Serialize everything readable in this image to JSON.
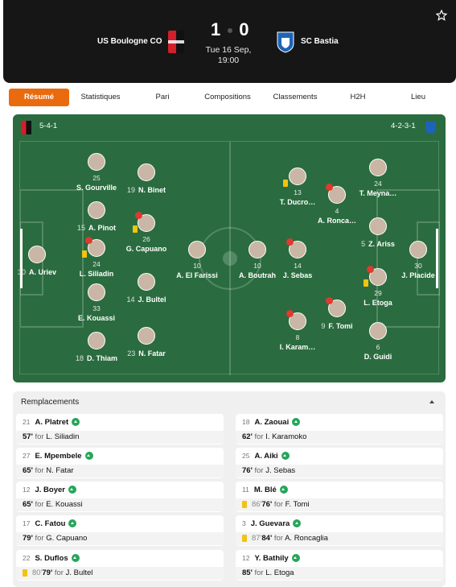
{
  "match": {
    "home_team": "US Boulogne CO",
    "away_team": "SC Bastia",
    "home_score": "1",
    "away_score": "0",
    "date": "Tue 16 Sep,",
    "time": "19:00"
  },
  "tabs": [
    "Résumé",
    "Statistiques",
    "Pari",
    "Compositions",
    "Classements",
    "H2H",
    "Lieu"
  ],
  "lineups": {
    "home_formation": "5-4-1",
    "away_formation": "4-2-3-1",
    "home_players": [
      {
        "num": "30",
        "name": "A. Uriev",
        "inline": true
      },
      {
        "num": "25",
        "name": "S. Gourville"
      },
      {
        "num": "15",
        "name": "A. Pinot",
        "inline": true
      },
      {
        "num": "24",
        "name": "L. Siliadin"
      },
      {
        "num": "33",
        "name": "E. Kouassi"
      },
      {
        "num": "18",
        "name": "D. Thiam",
        "inline": true
      },
      {
        "num": "19",
        "name": "N. Binet",
        "inline": true
      },
      {
        "num": "26",
        "name": "G. Capuano"
      },
      {
        "num": "14",
        "name": "J. Bultel",
        "inline": true
      },
      {
        "num": "23",
        "name": "N. Fatar",
        "inline": true
      },
      {
        "num": "10",
        "name": "A. El Farissi"
      }
    ],
    "away_players": [
      {
        "num": "10",
        "name": "A. Boutrah"
      },
      {
        "num": "14",
        "name": "J. Sebas"
      },
      {
        "num": "13",
        "name": "T. Ducro…"
      },
      {
        "num": "8",
        "name": "I. Karam…"
      },
      {
        "num": "4",
        "name": "A. Ronca…"
      },
      {
        "num": "9",
        "name": "F. Tomi",
        "inline": true
      },
      {
        "num": "24",
        "name": "T. Meyna…"
      },
      {
        "num": "5",
        "name": "Z. Ariss",
        "inline": true
      },
      {
        "num": "29",
        "name": "L. Etoga"
      },
      {
        "num": "6",
        "name": "D. Guidi"
      },
      {
        "num": "30",
        "name": "J. Placide"
      }
    ]
  },
  "substitutions": {
    "title": "Remplacements",
    "home": [
      {
        "num": "21",
        "name": "A. Platret",
        "minute": "57'",
        "for": "for",
        "replaced": "L. Siliadin"
      },
      {
        "num": "27",
        "name": "E. Mpembele",
        "minute": "65'",
        "for": "for",
        "replaced": "N. Fatar"
      },
      {
        "num": "12",
        "name": "J. Boyer",
        "minute": "65'",
        "for": "for",
        "replaced": "E. Kouassi"
      },
      {
        "num": "17",
        "name": "C. Fatou",
        "minute": "79'",
        "for": "for",
        "replaced": "G. Capuano"
      },
      {
        "num": "22",
        "name": "S. Duflos",
        "card_minute": "80'",
        "minute": "79'",
        "for": "for",
        "replaced": "J. Bultel"
      }
    ],
    "away": [
      {
        "num": "18",
        "name": "A. Zaouai",
        "minute": "62'",
        "for": "for",
        "replaced": "I. Karamoko"
      },
      {
        "num": "25",
        "name": "A. Aiki",
        "minute": "76'",
        "for": "for",
        "replaced": "J. Sebas"
      },
      {
        "num": "11",
        "name": "M. Blé",
        "card_minute": "86'",
        "minute": "76'",
        "for": "for",
        "replaced": "F. Tomi"
      },
      {
        "num": "3",
        "name": "J. Guevara",
        "card_minute": "87'",
        "minute": "84'",
        "for": "for",
        "replaced": "A. Roncaglia"
      },
      {
        "num": "12",
        "name": "Y. Bathily",
        "minute": "85'",
        "for": "for",
        "replaced": "L. Etoga"
      }
    ]
  },
  "colors": {
    "accent": "#ea6b0e",
    "pitch": "#2a6c3f",
    "header": "#161616",
    "sub_in": "#26a65b",
    "yellow_card": "#f1c40f"
  },
  "icons": {
    "favorite": "star-outline-icon",
    "sub_in": "arrow-up-circle-icon",
    "injury": "heart-icon",
    "collapse": "chevron-up-icon"
  }
}
